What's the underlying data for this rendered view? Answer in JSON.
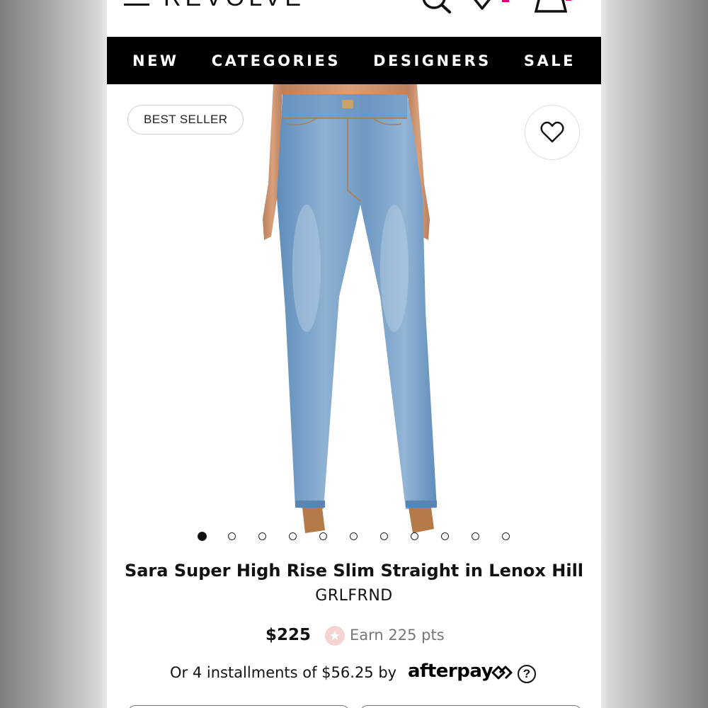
{
  "header": {
    "logo": "REVOLVE",
    "accent_color": "#d4007c"
  },
  "nav": {
    "items": [
      "NEW",
      "CATEGORIES",
      "DESIGNERS",
      "SALE"
    ]
  },
  "gallery": {
    "badge": "BEST SELLER",
    "slide_count": 11,
    "active_slide": 1
  },
  "product": {
    "title": "Sara Super High Rise Slim Straight in Lenox Hill",
    "brand": "GRLFRND",
    "price": "$225",
    "points": "Earn 225 pts",
    "installments": "Or 4 installments of $56.25 by",
    "afterpay_brand": "afterpay",
    "help": "?"
  }
}
